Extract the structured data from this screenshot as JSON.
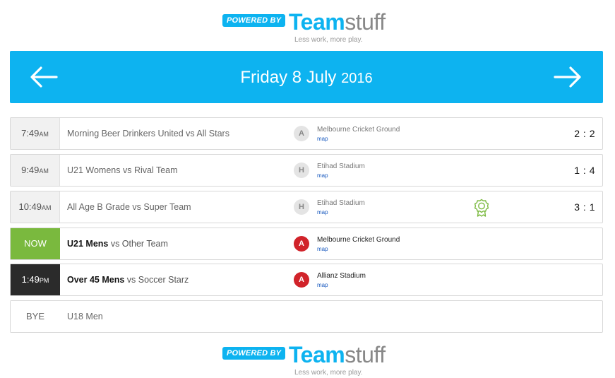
{
  "branding": {
    "powered_label": "POWERED BY",
    "wordmark_team": "Team",
    "wordmark_stuff": "stuff",
    "tagline": "Less work, more play."
  },
  "header": {
    "date_main": "Friday 8 July",
    "date_year": "2016",
    "prev_icon": "arrow-left-icon",
    "next_icon": "arrow-right-icon"
  },
  "colors": {
    "accent": "#0db3f0",
    "now": "#7ab93e",
    "live": "#2b2b2b",
    "away_badge": "#d1232a",
    "award": "#7ab93e"
  },
  "games": [
    {
      "time": "7:49",
      "ampm": "AM",
      "team": "Morning Beer Drinkers United",
      "vs": " vs All Stars",
      "venue_type": "A",
      "venue": "Melbourne Cricket Ground",
      "map": "map",
      "score": "2 : 2"
    },
    {
      "time": "9:49",
      "ampm": "AM",
      "team": "U21 Womens",
      "vs": " vs Rival Team",
      "venue_type": "H",
      "venue": "Etihad Stadium",
      "map": "map",
      "score": "1 : 4"
    },
    {
      "time": "10:49",
      "ampm": "AM",
      "team": "All Age B Grade",
      "vs": " vs Super Team",
      "venue_type": "H",
      "venue": "Etihad Stadium",
      "map": "map",
      "score": "3 : 1",
      "icon": "award-ribbon-icon"
    },
    {
      "time": "NOW",
      "team": "U21 Mens",
      "vs": " vs Other Team",
      "venue_type": "A",
      "venue": "Melbourne Cricket Ground",
      "map": "map"
    },
    {
      "time": "1:49",
      "ampm": "PM",
      "team": "Over 45 Mens",
      "vs": " vs Soccer Starz",
      "venue_type": "A",
      "venue": "Allianz Stadium",
      "map": "map"
    },
    {
      "time": "BYE",
      "team": "U18 Men"
    }
  ]
}
